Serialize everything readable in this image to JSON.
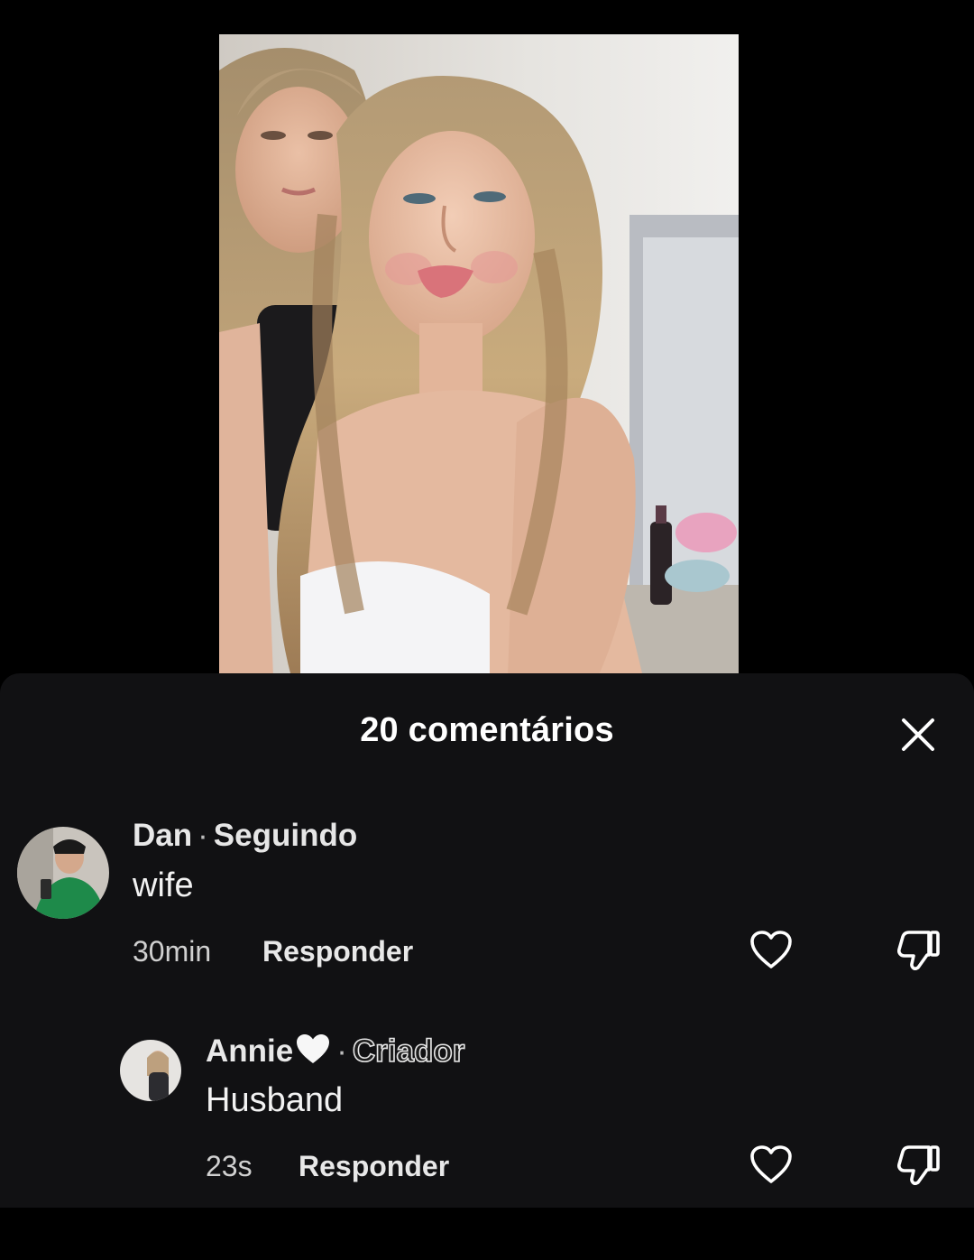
{
  "comments_panel": {
    "title": "20 comentários"
  },
  "comments": [
    {
      "author": "Dan",
      "separator": "·",
      "tag": "Seguindo",
      "text": "wife",
      "time": "30min",
      "reply_label": "Responder"
    },
    {
      "author": "Annie",
      "author_emoji": "white-heart-icon",
      "separator": "·",
      "tag": "Criador",
      "text": "Husband",
      "time": "23s",
      "reply_label": "Responder"
    }
  ],
  "colors": {
    "background": "#000000",
    "sheet": "#111113",
    "text": "#ffffff",
    "muted_text": "#d0d0d0"
  }
}
